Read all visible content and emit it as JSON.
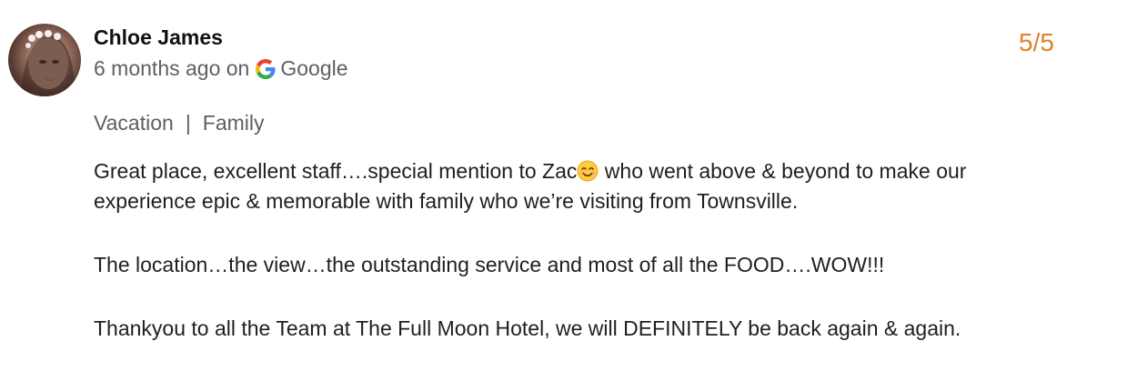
{
  "review": {
    "author_name": "Chloe James",
    "time_ago": "6 months ago on",
    "source": "Google",
    "source_icon": "google-g-icon",
    "rating": "5/5",
    "rating_color": "#e0802a",
    "tags": [
      "Vacation",
      "Family"
    ],
    "tag_separator": "|",
    "paragraph1_before_emoji": "Great place, excellent staff….special mention to Zac",
    "paragraph1_emoji": "smiling-face-emoji",
    "paragraph1_after_emoji": " who went above & beyond to make our experience epic & memorable with family who we’re visiting from Townsville.",
    "paragraph2": "The location…the view…the outstanding service and most of all the FOOD….WOW!!!",
    "paragraph3": "Thankyou to all the Team at The Full Moon Hotel, we will DEFINITELY be back again & again."
  }
}
